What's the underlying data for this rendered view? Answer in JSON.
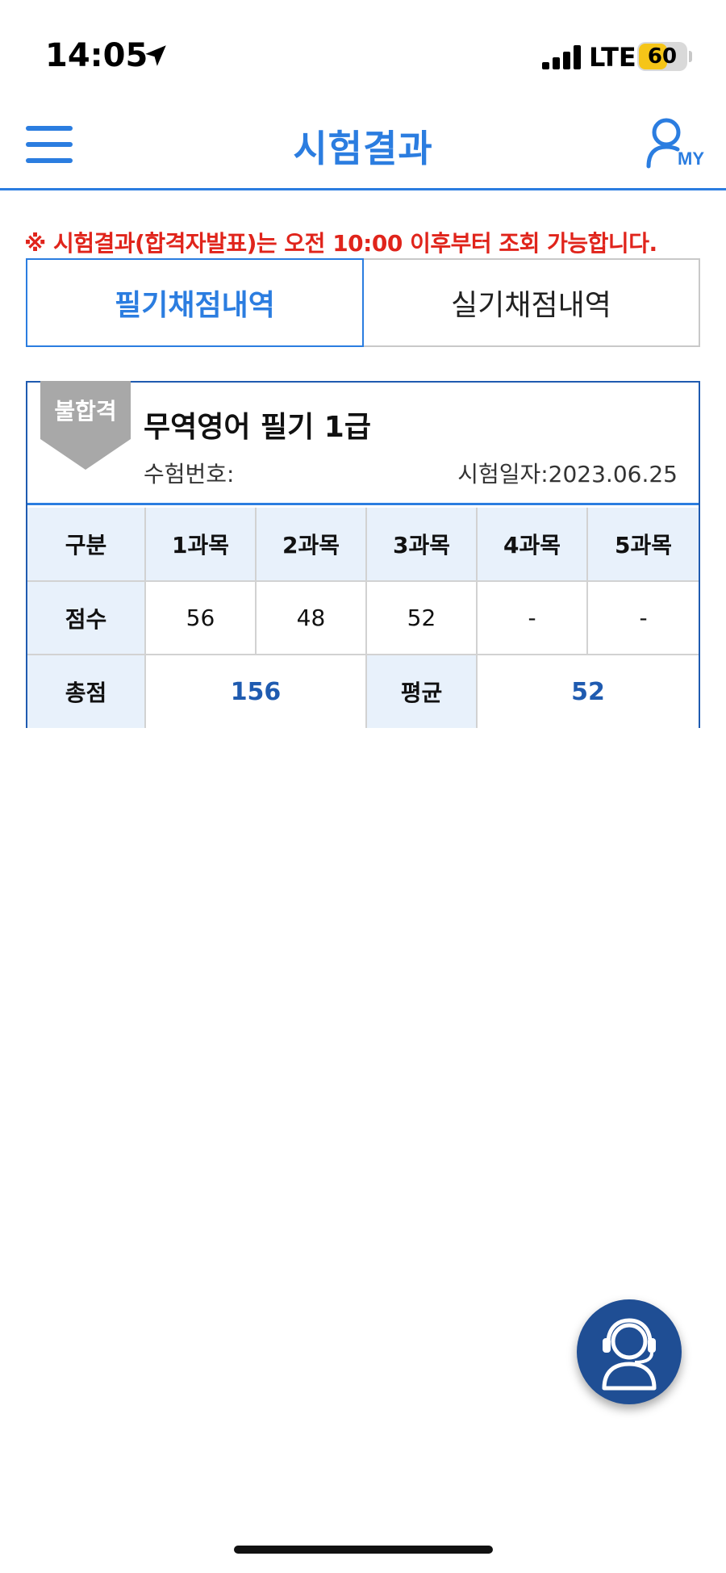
{
  "status_bar": {
    "time": "14:05",
    "network": "LTE",
    "battery": "60",
    "battery_level": 0.6
  },
  "header": {
    "title": "시험결과",
    "my_label": "MY"
  },
  "notice": {
    "mark": "※",
    "text_part1": " 시험결과(합격자발표)는 오전 ",
    "time": "10:00",
    "text_part2": " 이후부터 조회 가능합니다."
  },
  "tabs": [
    {
      "label": "필기채점내역",
      "active": true
    },
    {
      "label": "실기채점내역",
      "active": false
    }
  ],
  "result": {
    "badge": "불합격",
    "exam_name": "무역영어 필기 1급",
    "exam_number_label": "수험번호:",
    "exam_number": "",
    "exam_date_label": "시험일자:",
    "exam_date": "2023.06.25",
    "table": {
      "header_label": "구분",
      "subjects": [
        "1과목",
        "2과목",
        "3과목",
        "4과목",
        "5과목"
      ],
      "score_label": "점수",
      "scores": [
        "56",
        "48",
        "52",
        "-",
        "-"
      ],
      "total_label": "총점",
      "total": "156",
      "average_label": "평균",
      "average": "52"
    }
  },
  "colors": {
    "primary": "#2b7de0",
    "dark_blue": "#1f5bb0",
    "notice_red": "#e0241b",
    "badge_gray": "#a8a8a8",
    "header_cell_bg": "#e8f1fb",
    "support_button_bg": "#1f4e94"
  },
  "icons": {
    "menu": "hamburger-menu-icon",
    "my": "user-icon",
    "support": "headset-agent-icon",
    "location": "location-arrow-icon"
  }
}
